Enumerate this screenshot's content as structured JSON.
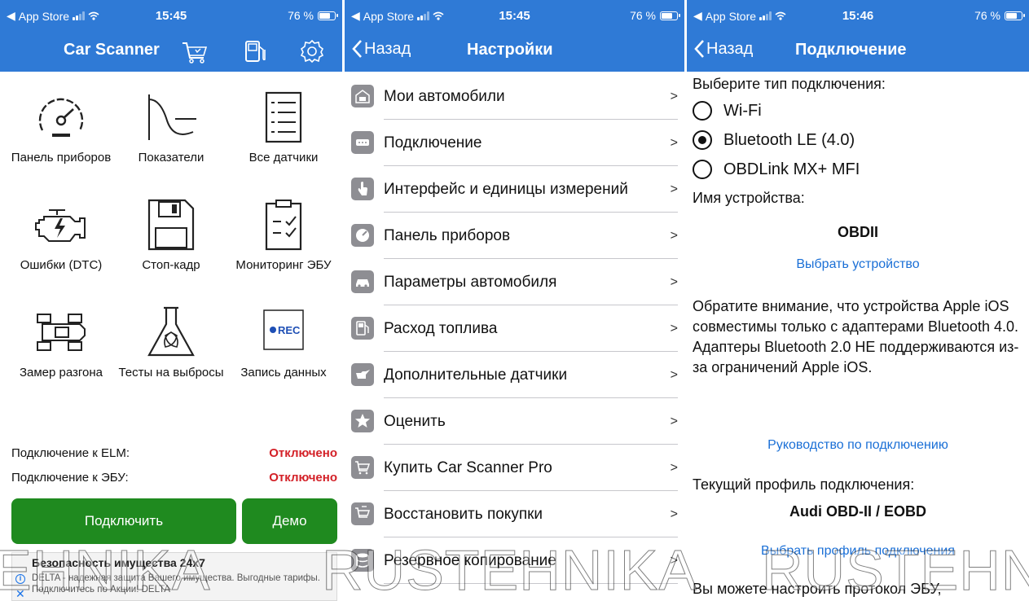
{
  "status": {
    "carrier": "App Store",
    "battery": "76 %",
    "battery_level": 0.76,
    "time1": "15:45",
    "time2": "15:45",
    "time3": "15:46"
  },
  "colors": {
    "accent": "#2f7ad6",
    "green": "#1f8a1f",
    "red": "#d32027",
    "link": "#1a6fd6"
  },
  "screen1": {
    "title": "Car Scanner",
    "icons": [
      "cart-icon",
      "fuel-pump-icon",
      "gear-icon"
    ],
    "tiles": [
      {
        "label": "Панель приборов",
        "icon": "speedometer-icon"
      },
      {
        "label": "Показатели",
        "icon": "graph-curve-icon"
      },
      {
        "label": "Все датчики",
        "icon": "list-icon"
      },
      {
        "label": "Ошибки (DTC)",
        "icon": "engine-icon"
      },
      {
        "label": "Стоп-кадр",
        "icon": "floppy-disk-icon"
      },
      {
        "label": "Мониторинг ЭБУ",
        "icon": "clipboard-check-icon"
      },
      {
        "label": "Замер разгона",
        "icon": "race-car-icon"
      },
      {
        "label": "Тесты на выбросы",
        "icon": "flask-leaf-icon"
      },
      {
        "label": "Запись данных",
        "icon": "rec-icon"
      }
    ],
    "rec_text": "REC",
    "elm_label": "Подключение к ELM:",
    "elm_value": "Отключено",
    "ecu_label": "Подключение к ЭБУ:",
    "ecu_value": "Отключено",
    "connect_button": "Подключить",
    "demo_button": "Демо",
    "ad_title": "Безопасность имущества 24x7",
    "ad_text": "DELTA - надежная защита Вашего имущества. Выгодные тарифы. Подключитесь по Акции! DELTA"
  },
  "screen2": {
    "back": "Назад",
    "title": "Настройки",
    "arrow": ">",
    "items": [
      {
        "label": "Мои автомобили",
        "icon": "garage-icon"
      },
      {
        "label": "Подключение",
        "icon": "connector-icon"
      },
      {
        "label": "Интерфейс и единицы измерений",
        "icon": "hand-pointer-icon"
      },
      {
        "label": "Панель приборов",
        "icon": "gauge-icon"
      },
      {
        "label": "Параметры автомобиля",
        "icon": "car-icon"
      },
      {
        "label": "Расход топлива",
        "icon": "fuel-pump-icon"
      },
      {
        "label": "Дополнительные датчики",
        "icon": "oil-can-icon"
      },
      {
        "label": "Оценить",
        "icon": "star-icon"
      },
      {
        "label": "Купить Car Scanner Pro",
        "icon": "cart-icon"
      },
      {
        "label": "Восстановить покупки",
        "icon": "cart-restore-icon"
      },
      {
        "label": "Резервное копирование",
        "icon": "database-icon"
      }
    ]
  },
  "screen3": {
    "back": "Назад",
    "title": "Подключение",
    "choose_type": "Выберите тип подключения:",
    "options": [
      "Wi-Fi",
      "Bluetooth LE (4.0)",
      "OBDLink MX+ MFI"
    ],
    "selected_index": 1,
    "device_name_label": "Имя устройства:",
    "device_name": "OBDII",
    "choose_device": "Выбрать устройство",
    "note": "Обратите внимание, что устройства Apple iOS совместимы только с адаптерами Bluetooth 4.0. Адаптеры Bluetooth 2.0 НЕ поддерживаются из-за ограничений Apple iOS.",
    "guide_link": "Руководство по подключению",
    "profile_label": "Текущий профиль подключения:",
    "profile": "Audi OBD-II / EOBD",
    "choose_profile": "Выбрать профиль подключения",
    "ecu_protocol": "Вы можете настроить протокол ЭБУ,"
  },
  "watermark": {
    "left": "EHNIKA",
    "center": "RUSTEHNIKA",
    "right": "RUSTEHNIK"
  }
}
